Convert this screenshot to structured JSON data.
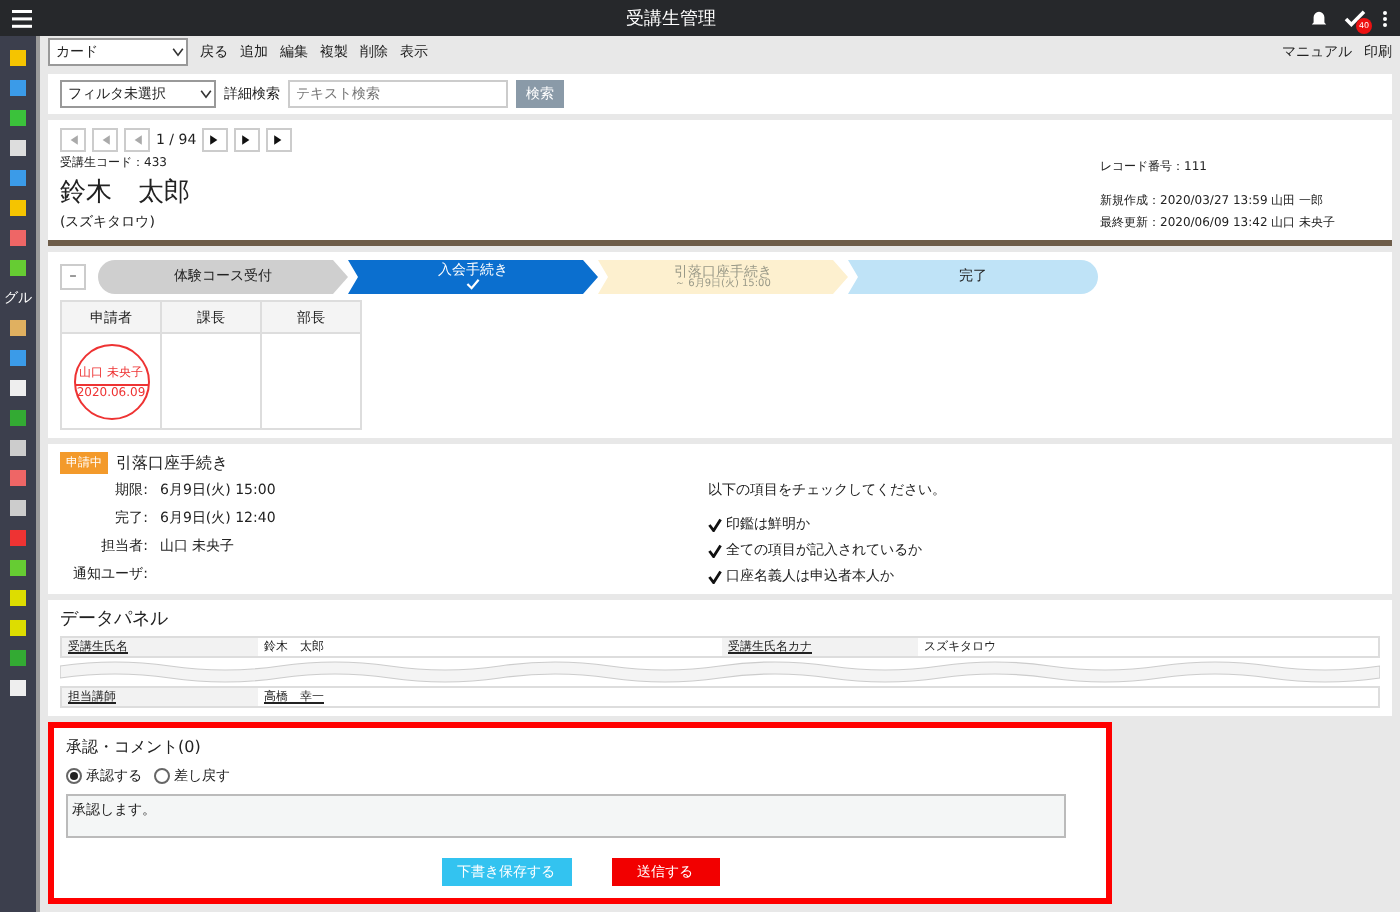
{
  "window": {
    "title": "受講生管理",
    "notification_count": "40"
  },
  "sidebar": {
    "label": "グル"
  },
  "toolbar": {
    "view_select": "カード",
    "actions": [
      "戻る",
      "追加",
      "編集",
      "複製",
      "削除",
      "表示"
    ],
    "right_actions": [
      "マニュアル",
      "印刷"
    ]
  },
  "filter": {
    "select": "フィルタ未選択",
    "advanced": "詳細検索",
    "search_placeholder": "テキスト検索",
    "search_button": "検索"
  },
  "record": {
    "pager": "1 / 94",
    "code": "受講生コード：433",
    "name": "鈴木　太郎",
    "kana": "(スズキタロウ)",
    "number": "レコード番号：111",
    "created": "新規作成：2020/03/27 13:59 山田 一郎",
    "updated": "最終更新：2020/06/09 13:42 山口 未央子"
  },
  "workflow": {
    "collapse_label": "−",
    "steps": [
      {
        "label": "体験コース受付",
        "kind": "done"
      },
      {
        "label": "入会手続き",
        "kind": "current"
      },
      {
        "label": "引落口座手続き",
        "sub": "～ 6月9日(火) 15:00",
        "kind": "pending"
      },
      {
        "label": "完了",
        "kind": "final"
      }
    ]
  },
  "approval": {
    "columns": [
      "申請者",
      "課長",
      "部長"
    ],
    "stamp": {
      "name": "山口 未央子",
      "date": "2020.06.09"
    }
  },
  "task": {
    "badge": "申請中",
    "title": "引落口座手続き",
    "fields": [
      {
        "label": "期限:",
        "value": "6月9日(火) 15:00"
      },
      {
        "label": "完了:",
        "value": "6月9日(火) 12:40"
      },
      {
        "label": "担当者:",
        "value": "山口 未央子"
      },
      {
        "label": "通知ユーザ:"
      }
    ],
    "check_intro": "以下の項目をチェックしてください。",
    "checks": [
      {
        "label": "印鑑は鮮明か",
        "checked": true
      },
      {
        "label": "全ての項目が記入されているか",
        "checked": true
      },
      {
        "label": "口座名義人は申込者本人か",
        "checked": true
      }
    ]
  },
  "data_panel": {
    "title": "データパネル",
    "rows": [
      {
        "cells": [
          {
            "label": "受講生氏名",
            "value": "鈴木　太郎"
          },
          {
            "label": "受講生氏名カナ",
            "value": "スズキタロウ"
          }
        ]
      },
      {
        "cells": [
          {
            "label": "担当講師",
            "value": "高橋　幸一"
          }
        ]
      }
    ]
  },
  "comment": {
    "title": "承認・コメント(0)",
    "options": [
      {
        "label": "承認する",
        "selected": true
      },
      {
        "label": "差し戻す",
        "selected": false
      }
    ],
    "text": "承認します。",
    "buttons": [
      {
        "label": "下書き保存する",
        "kind": "draft"
      },
      {
        "label": "送信する",
        "kind": "send"
      }
    ]
  }
}
